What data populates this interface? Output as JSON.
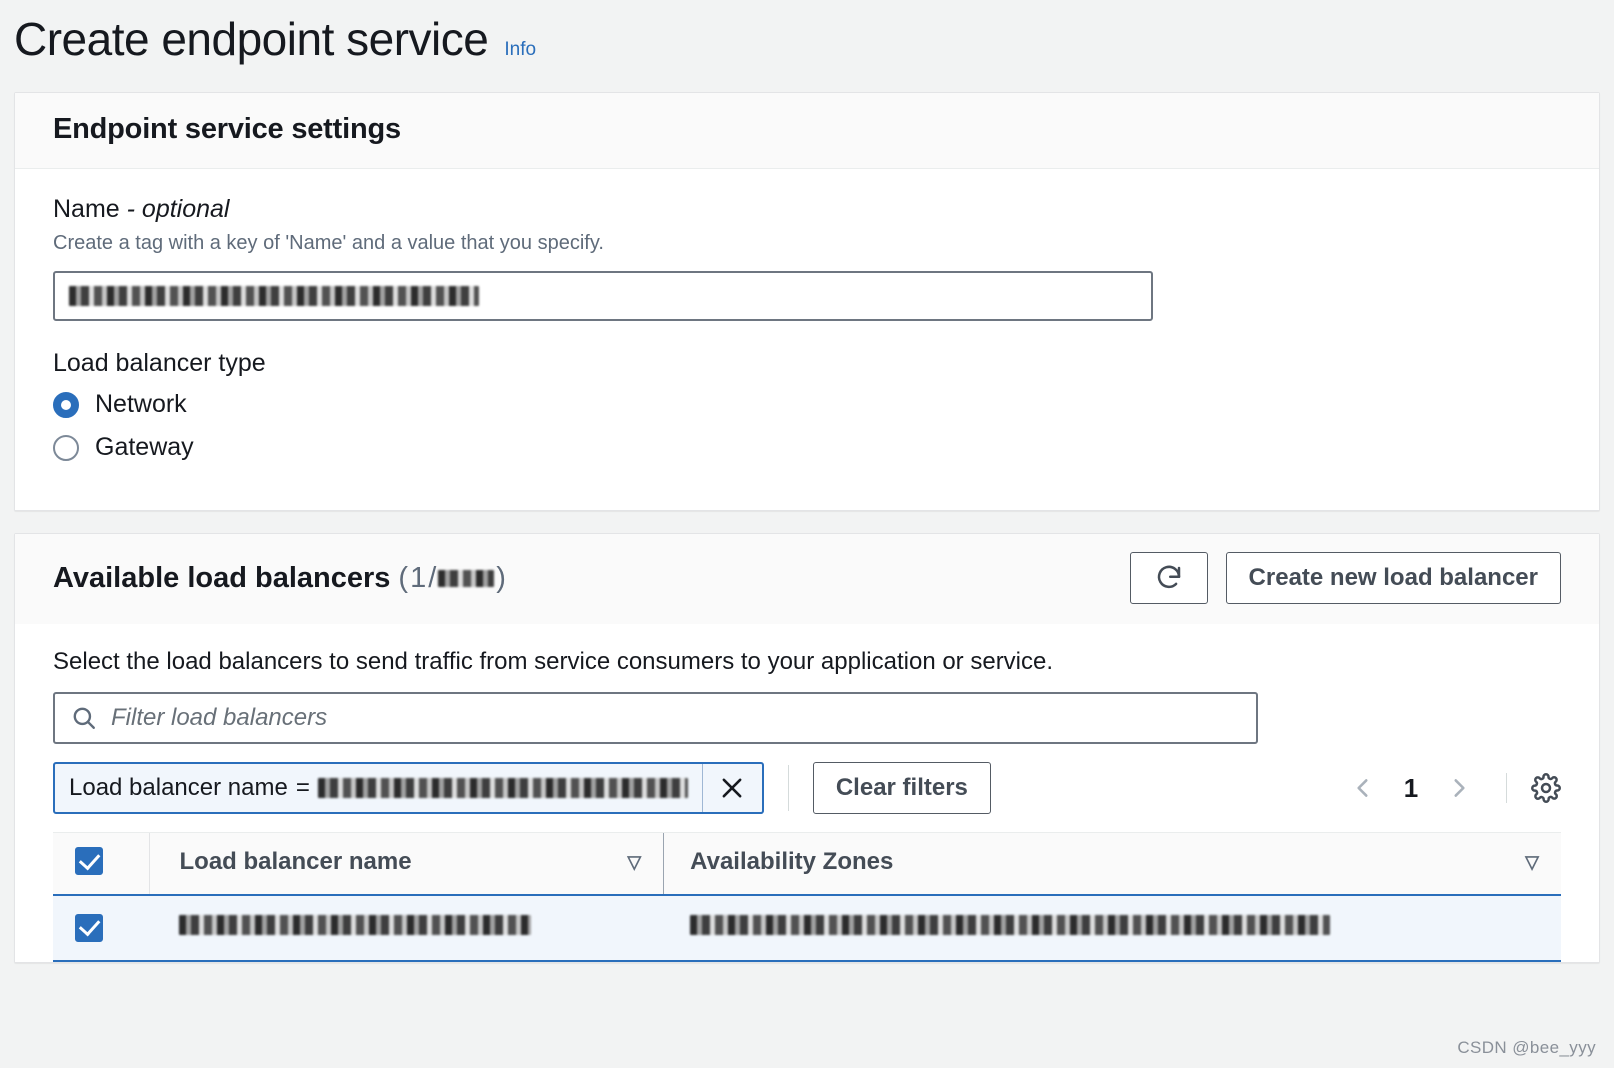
{
  "header": {
    "title": "Create endpoint service",
    "info_label": "Info"
  },
  "settings_panel": {
    "title": "Endpoint service settings",
    "name_field": {
      "label": "Name",
      "optional_suffix": "- optional",
      "description": "Create a tag with a key of 'Name' and a value that you specify.",
      "value": "",
      "value_redacted": true
    },
    "load_balancer_type": {
      "label": "Load balancer type",
      "options": [
        {
          "label": "Network",
          "selected": true
        },
        {
          "label": "Gateway",
          "selected": false
        }
      ]
    }
  },
  "load_balancers_panel": {
    "title": "Available load balancers",
    "count_selected": "1",
    "count_total_redacted": true,
    "count_separator": "/",
    "refresh_icon": "refresh-icon",
    "create_button_label": "Create new load balancer",
    "description": "Select the load balancers to send traffic from service consumers to your application or service.",
    "filter": {
      "placeholder": "Filter load balancers",
      "value": "",
      "search_icon": "search-icon"
    },
    "filter_token": {
      "label": "Load balancer name",
      "operator": "=",
      "value_redacted": true,
      "remove_icon": "close-icon"
    },
    "clear_filters_label": "Clear filters",
    "pagination": {
      "prev_icon": "chevron-left-icon",
      "next_icon": "chevron-right-icon",
      "current_page": "1"
    },
    "settings_icon": "gear-icon",
    "table": {
      "columns": [
        {
          "label": "Load balancer name",
          "sortable": true,
          "sort_icon": "sort-descending-icon"
        },
        {
          "label": "Availability Zones",
          "sortable": true,
          "sort_icon": "sort-descending-icon"
        }
      ],
      "select_all_checked": true,
      "rows": [
        {
          "selected": true,
          "load_balancer_name_redacted": true,
          "availability_zones_redacted": true
        }
      ]
    }
  },
  "watermark": "CSDN @bee_yyy",
  "colors": {
    "accent": "#2a6ebb",
    "page_background": "#f2f3f3",
    "card_background": "#ffffff",
    "selected_row": "#f1f6fc",
    "muted_text": "#5f6b7a"
  }
}
